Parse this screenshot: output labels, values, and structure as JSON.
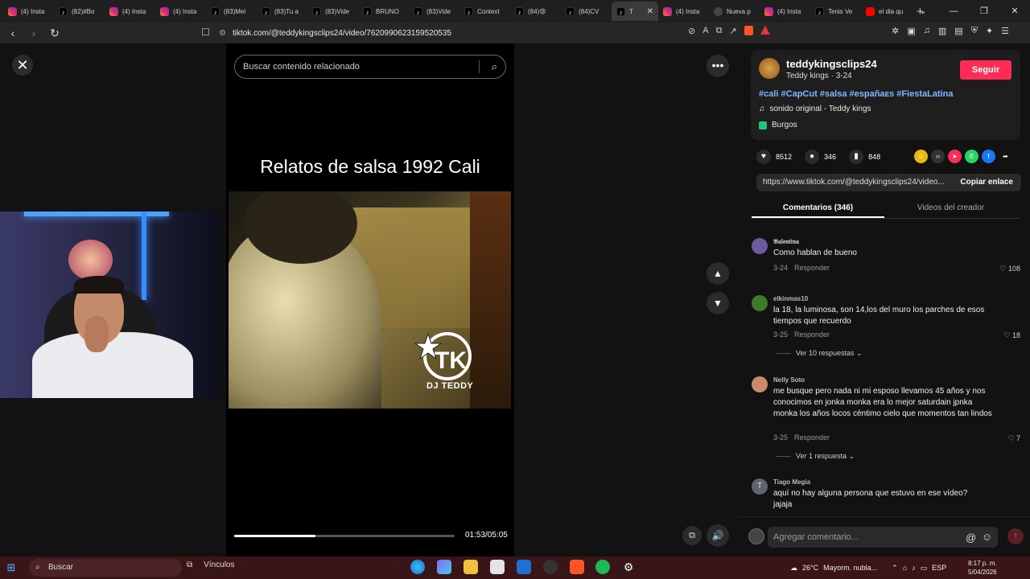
{
  "browser": {
    "tabs": [
      {
        "label": "(4) Insta",
        "icon": "instagram"
      },
      {
        "label": "(82)#Bo",
        "icon": "tiktok"
      },
      {
        "label": "(4) Insta",
        "icon": "instagram"
      },
      {
        "label": "(4) Insta",
        "icon": "instagram"
      },
      {
        "label": "(83)Mel",
        "icon": "tiktok"
      },
      {
        "label": "(83)Tu a",
        "icon": "tiktok"
      },
      {
        "label": "(83)Vide",
        "icon": "tiktok"
      },
      {
        "label": "BRUNO",
        "icon": "tiktok"
      },
      {
        "label": "(83)Vide",
        "icon": "tiktok"
      },
      {
        "label": "Context",
        "icon": "tiktok"
      },
      {
        "label": "(84)😡",
        "icon": "tiktok"
      },
      {
        "label": "(84)CV",
        "icon": "tiktok"
      },
      {
        "label": "T",
        "icon": "tiktok",
        "active": true
      },
      {
        "label": "(4) Insta",
        "icon": "instagram"
      },
      {
        "label": "Nueva p",
        "icon": "shield"
      },
      {
        "label": "(4) Insta",
        "icon": "instagram"
      },
      {
        "label": "Tenis Ve",
        "icon": "tiktok"
      },
      {
        "label": "el dia qu",
        "icon": "youtube"
      }
    ],
    "url": "tiktok.com/@teddykingsclips24/video/7620990623159520535"
  },
  "video": {
    "search_placeholder": "Buscar contenido relacionado",
    "overlay_title": "Relatos de salsa 1992 Cali",
    "logo_text": "DJ TEDDY",
    "time": "01:53/05:05",
    "progress": 0.37
  },
  "post": {
    "username": "teddykingsclips24",
    "nickname": "Teddy kings · 3-24",
    "follow_label": "Seguir",
    "hashtags": "#cali #CapCut #salsa #españaᴇs #FiestaLatina",
    "sound": "sonido original - Teddy kings",
    "location": "Burgos",
    "likes": "8512",
    "comments": "346",
    "saves": "848",
    "link": "https://www.tiktok.com/@teddykingsclips24/video...",
    "copy_label": "Copiar enlace",
    "tab_comments": "Comentarios (346)",
    "tab_videos": "Videos del creador"
  },
  "comments": [
    {
      "name": "𝕭𝖆𝖑𝖊𝖓𝖙𝖎𝖓𝖆",
      "text": "Como hablan de bueno",
      "date": "3-24",
      "reply": "Responder",
      "likes": "108",
      "color": "#6b5a9e"
    },
    {
      "name": "elkinmas10",
      "text": "la 18, la luminosa, son 14,los del muro los parches de esos tiempos que recuerdo",
      "date": "3-25",
      "reply": "Responder",
      "likes": "18",
      "more": "Ver 10 respuestas",
      "color": "#3d7a2a"
    },
    {
      "name": "Nelly Soto",
      "text": "me busque pero nada ni mi esposo llevamos 45 años y nos conocimos en jonka monka era lo mejor saturdain jpnka monka los años locos céntimo cielo que momentos tan lindos",
      "date": "3-25",
      "reply": "Responder",
      "likes": "7",
      "more": "Ver 1 respuesta",
      "color": "#c98a6e"
    },
    {
      "name": "Tiago Megia",
      "text": "aquí no hay alguna persona que estuvo en ese vídeo? jajaja",
      "initial": "T",
      "color": "#5c6470"
    }
  ],
  "composer": {
    "placeholder": "Agregar comentario..."
  },
  "taskbar": {
    "search": "Buscar",
    "links": "Vínculos",
    "weather": "26°C",
    "weather_text": "Mayorm. nubla...",
    "lang": "ESP",
    "time": "8:17 p. m.",
    "date": "5/04/2026"
  },
  "colors": {
    "accent": "#fe2c55",
    "hashtag": "#80b8ff"
  }
}
